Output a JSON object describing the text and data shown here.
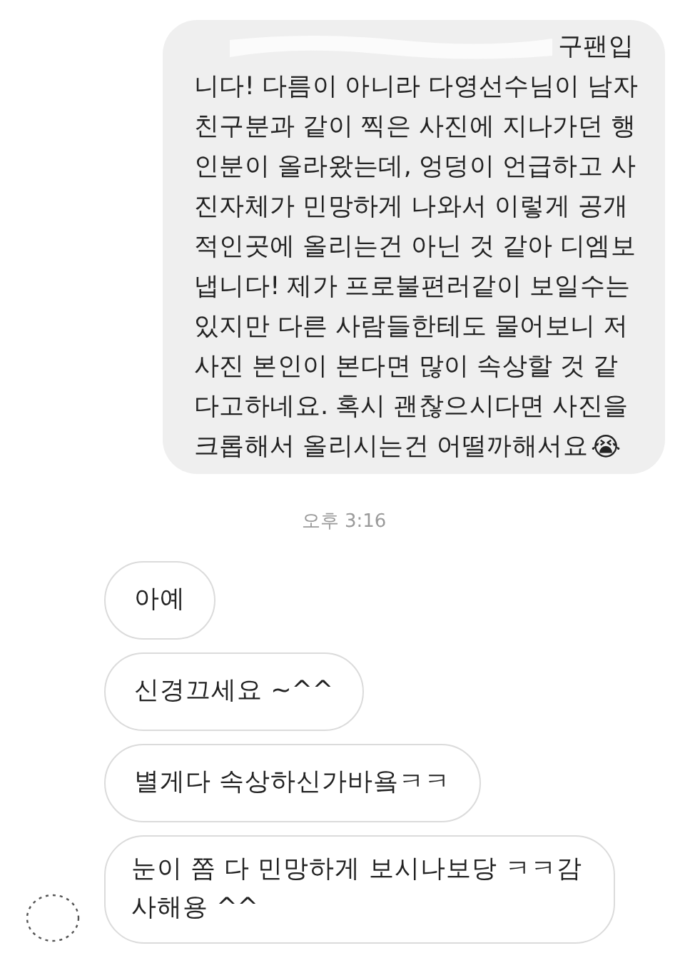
{
  "outgoing_message": {
    "redacted": true,
    "lines": [
      "구팬입",
      "니다! 다름이 아니라 다영선수님이 남자",
      "친구분과 같이 찍은 사진에 지나가던 행",
      "인분이 올라왔는데, 엉덩이 언급하고 사",
      "진자체가 민망하게 나와서 이렇게 공개",
      "적인곳에 올리는건 아닌 것 같아 디엠보",
      "냅니다! 제가 프로불편러같이 보일수는",
      "있지만 다른 사람들한테도 물어보니 저",
      "사진 본인이 본다면 많이 속상할 것 같",
      "다고하네요. 혹시 괜찮으시다면 사진을",
      "크롭해서 올리시는건 어떨까해서요"
    ],
    "emoji": "😭"
  },
  "timestamp": "오후 3:16",
  "incoming_messages": [
    {
      "lines": [
        "아예"
      ]
    },
    {
      "lines": [
        "신경끄세요 ~^^"
      ]
    },
    {
      "lines": [
        "별게다 속상하신가바욬ㅋㅋ"
      ]
    },
    {
      "lines": [
        "눈이 쫌 다 민망하게 보시나보당 ㅋㅋ감",
        "사해용 ^^"
      ],
      "avatar": true
    }
  ]
}
